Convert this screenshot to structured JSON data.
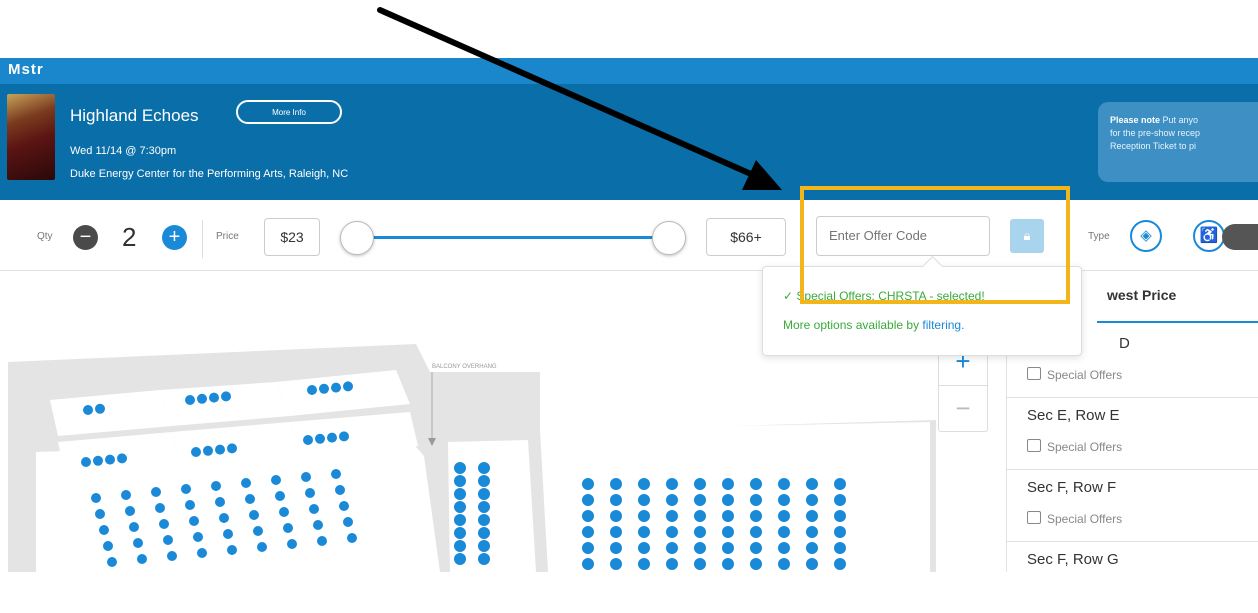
{
  "topbar": {
    "brand": "Mstr"
  },
  "event": {
    "title": "Highland Echoes",
    "more_info": "More Info",
    "date": "Wed 11/14 @ 7:30pm",
    "venue": "Duke Energy Center for the Performing Arts, Raleigh, NC"
  },
  "note": {
    "bold": "Please note",
    "line1": " Put anyo",
    "line2": "for the pre-show recep",
    "line3": "Reception Ticket to pi"
  },
  "filters": {
    "qty_label": "Qty",
    "qty_value": "2",
    "price_label": "Price",
    "price_min": "$23",
    "price_max": "$66+",
    "offer_placeholder": "Enter Offer Code",
    "type_label": "Type"
  },
  "tooltip": {
    "line1": "✓ Special Offers: CHRSTA - selected!",
    "line2_prefix": "More options available by ",
    "line2_link": "filtering."
  },
  "listing": {
    "sort_label": "west Price",
    "rows": [
      {
        "title": "D",
        "sub": "Special Offers"
      },
      {
        "title": "Sec E, Row E",
        "sub": "Special Offers"
      },
      {
        "title": "Sec F, Row F",
        "sub": "Special Offers"
      },
      {
        "title": "Sec F, Row G",
        "sub": ""
      }
    ]
  },
  "map": {
    "balcony_label": "BALCONY OVERHANG"
  },
  "colors": {
    "accent": "#1a8ad8",
    "header": "#0a6ea8",
    "highlight": "#f2b51a",
    "success": "#3aaa3a"
  }
}
